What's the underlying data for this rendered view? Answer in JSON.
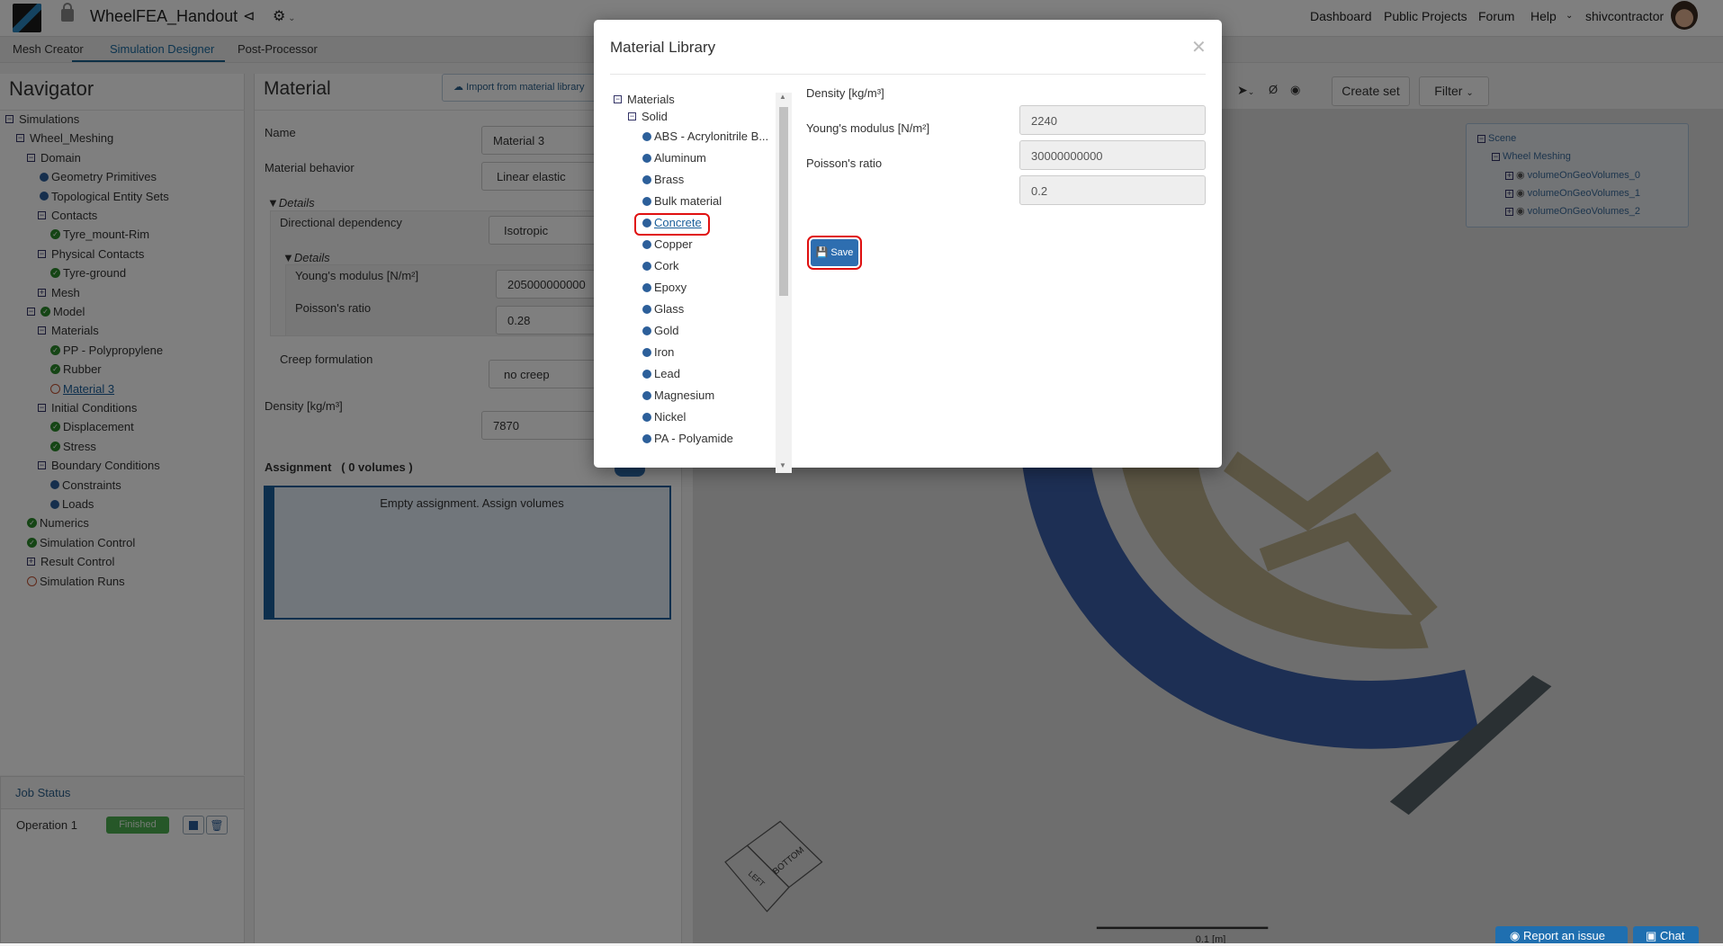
{
  "header": {
    "title": "WheelFEA_Handout",
    "nav": [
      "Dashboard",
      "Public Projects",
      "Forum",
      "Help",
      "shivcontractor"
    ],
    "icons": [
      "lock-icon",
      "share-icon",
      "gear-icon",
      "avatar"
    ]
  },
  "tabs": [
    "Mesh Creator",
    "Simulation Designer",
    "Post-Processor"
  ],
  "navigator": {
    "title": "Navigator",
    "tree": [
      {
        "label": "Simulations",
        "depth": 0,
        "icon": "minus"
      },
      {
        "label": "Wheel_Meshing",
        "depth": 1,
        "icon": "minus"
      },
      {
        "label": "Domain",
        "depth": 2,
        "icon": "minus"
      },
      {
        "label": "Geometry Primitives",
        "depth": 3,
        "icon": "dot"
      },
      {
        "label": "Topological Entity Sets",
        "depth": 3,
        "icon": "dot"
      },
      {
        "label": "Contacts",
        "depth": 3,
        "icon": "minus"
      },
      {
        "label": "Tyre_mount-Rim",
        "depth": 4,
        "icon": "check"
      },
      {
        "label": "Physical Contacts",
        "depth": 3,
        "icon": "minus"
      },
      {
        "label": "Tyre-ground",
        "depth": 4,
        "icon": "check"
      },
      {
        "label": "Mesh",
        "depth": 3,
        "icon": "plus"
      },
      {
        "label": "Model",
        "depth": 2,
        "icon": "minus-check"
      },
      {
        "label": "Materials",
        "depth": 3,
        "icon": "minus"
      },
      {
        "label": "PP - Polypropylene",
        "depth": 4,
        "icon": "check"
      },
      {
        "label": "Rubber",
        "depth": 4,
        "icon": "check"
      },
      {
        "label": "Material 3",
        "depth": 4,
        "icon": "ring",
        "link": true
      },
      {
        "label": "Initial Conditions",
        "depth": 3,
        "icon": "minus"
      },
      {
        "label": "Displacement",
        "depth": 4,
        "icon": "check"
      },
      {
        "label": "Stress",
        "depth": 4,
        "icon": "check"
      },
      {
        "label": "Boundary Conditions",
        "depth": 3,
        "icon": "minus"
      },
      {
        "label": "Constraints",
        "depth": 4,
        "icon": "dot"
      },
      {
        "label": "Loads",
        "depth": 4,
        "icon": "dot"
      },
      {
        "label": "Numerics",
        "depth": 2,
        "icon": "check"
      },
      {
        "label": "Simulation Control",
        "depth": 2,
        "icon": "check"
      },
      {
        "label": "Result Control",
        "depth": 2,
        "icon": "plus"
      },
      {
        "label": "Simulation Runs",
        "depth": 2,
        "icon": "ring"
      }
    ]
  },
  "job_status": {
    "title": "Job Status",
    "operation": "Operation 1",
    "status": "Finished"
  },
  "material": {
    "title": "Material",
    "import_label": "Import from material library",
    "name_label": "Name",
    "name_value": "Material 3",
    "behavior_label": "Material behavior",
    "behavior_value": "Linear elastic",
    "details_label": "Details",
    "directional_label": "Directional dependency",
    "directional_value": "Isotropic",
    "youngs_label": "Young's modulus [N/m²]",
    "youngs_value": "205000000000",
    "poisson_label": "Poisson's ratio",
    "poisson_value": "0.28",
    "creep_label": "Creep formulation",
    "creep_value": "no creep",
    "density_label": "Density [kg/m³]",
    "density_value": "7870",
    "assignment_label": "Assignment",
    "assignment_count": "( 0 volumes )",
    "empty_text": "Empty assignment. Assign volumes"
  },
  "viewer": {
    "create_set": "Create set",
    "filter": "Filter",
    "scene": {
      "root": "Scene",
      "child": "Wheel Meshing",
      "volumes": [
        "volumeOnGeoVolumes_0",
        "volumeOnGeoVolumes_1",
        "volumeOnGeoVolumes_2"
      ]
    },
    "scale_label": "0.1 [m]",
    "cube_faces": [
      "BOTTOM",
      "LEFT"
    ]
  },
  "bottom": {
    "report": "Report an issue",
    "chat": "Chat"
  },
  "modal": {
    "title": "Material Library",
    "root": "Materials",
    "group": "Solid",
    "items": [
      "ABS - Acrylonitrile B...",
      "Aluminum",
      "Brass",
      "Bulk material",
      "Concrete",
      "Copper",
      "Cork",
      "Epoxy",
      "Glass",
      "Gold",
      "Iron",
      "Lead",
      "Magnesium",
      "Nickel",
      "PA - Polyamide"
    ],
    "selected": "Concrete",
    "fields": [
      {
        "label": "Density [kg/m³]",
        "value": "2240"
      },
      {
        "label": "Young's modulus [N/m²]",
        "value": "30000000000"
      },
      {
        "label": "Poisson's ratio",
        "value": "0.2"
      }
    ],
    "save_label": "Save"
  },
  "colors": {
    "accent": "#2e6eb0",
    "highlight": "#e01010",
    "success": "#2a8a2a"
  }
}
